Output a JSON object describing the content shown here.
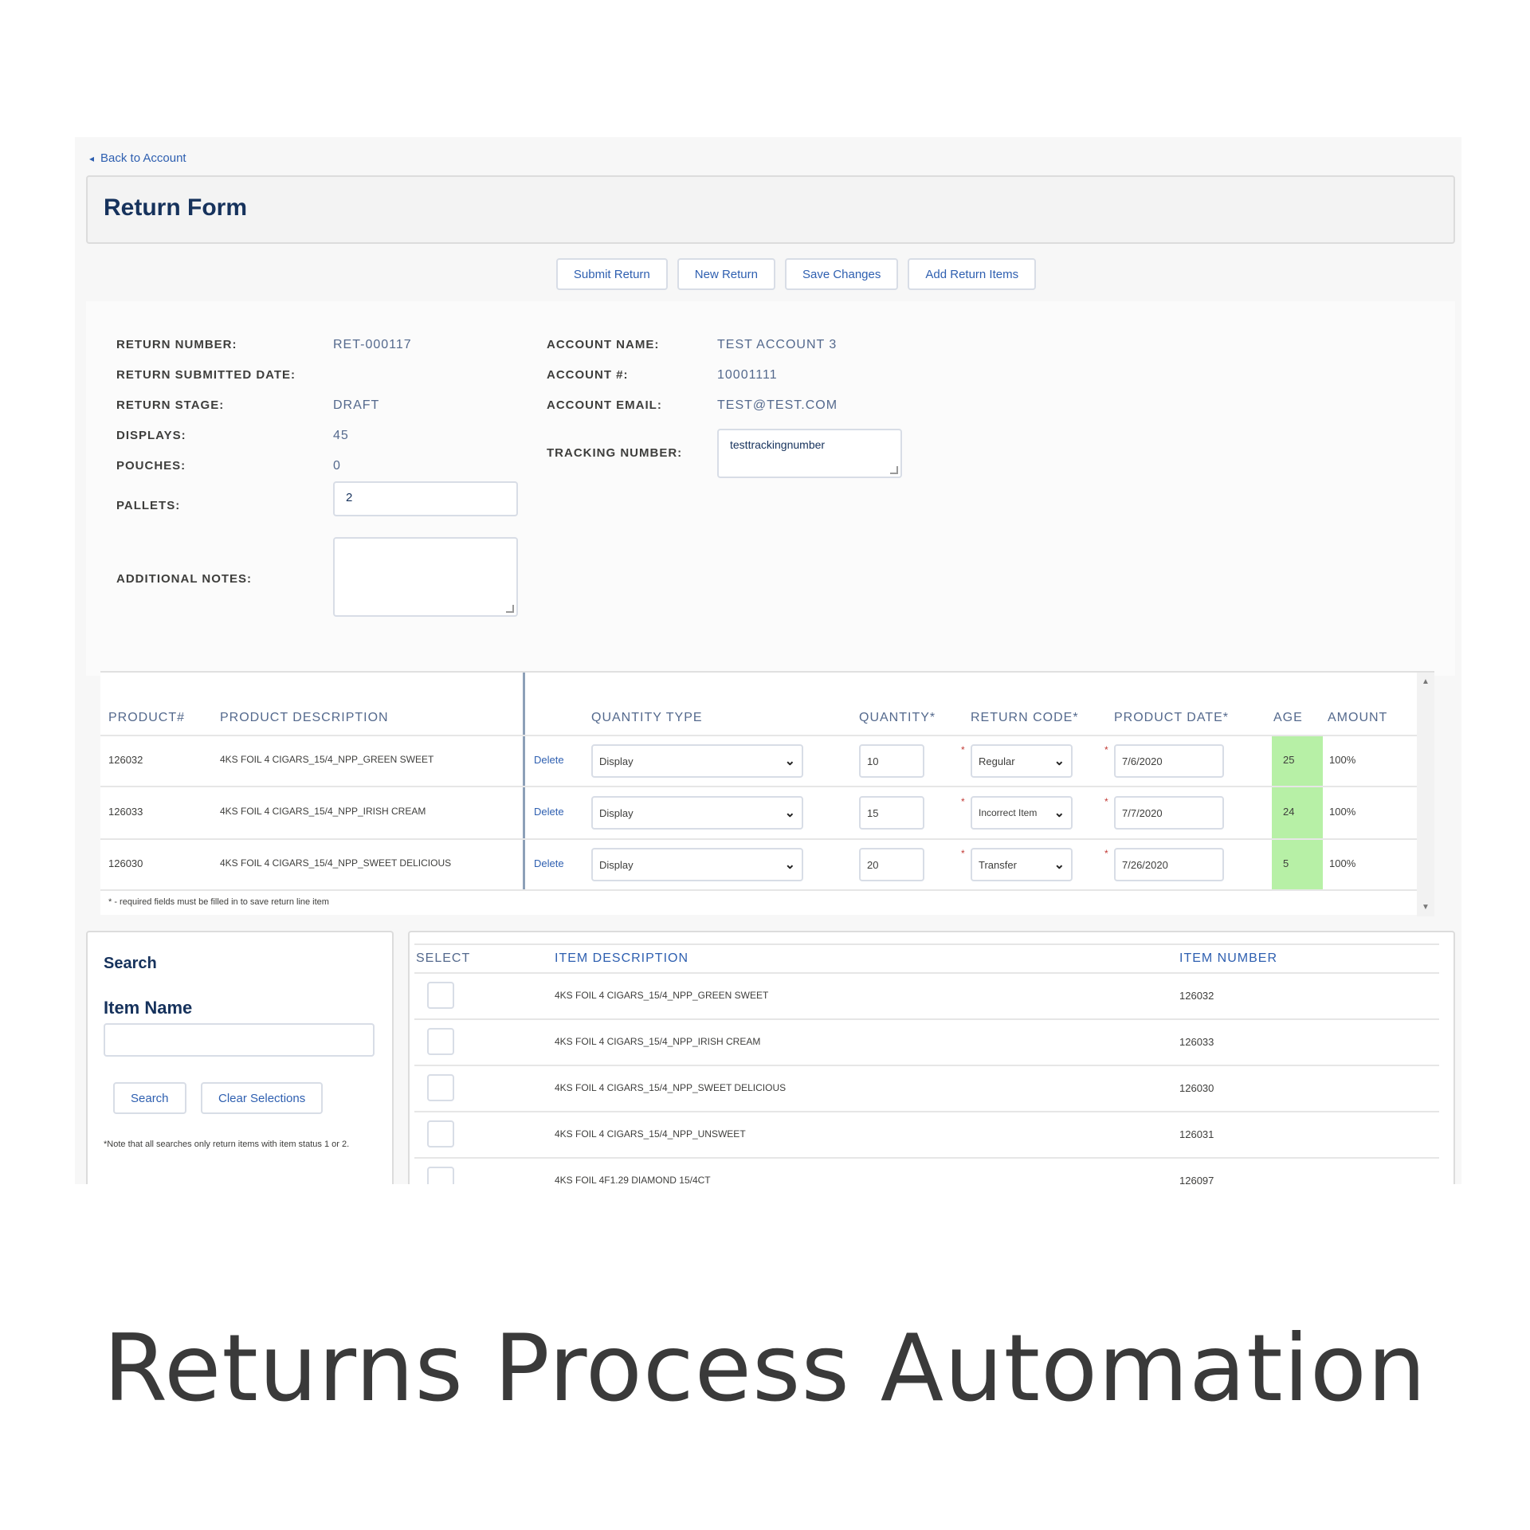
{
  "back_link": "Back to Account",
  "page_title": "Return Form",
  "buttons": {
    "submit": "Submit Return",
    "new": "New Return",
    "save": "Save Changes",
    "add": "Add Return Items"
  },
  "details": {
    "return_number_label": "RETURN NUMBER:",
    "return_number": "RET-000117",
    "submitted_date_label": "RETURN SUBMITTED DATE:",
    "stage_label": "RETURN STAGE:",
    "stage": "DRAFT",
    "displays_label": "DISPLAYS:",
    "displays": "45",
    "pouches_label": "POUCHES:",
    "pouches": "0",
    "pallets_label": "PALLETS:",
    "pallets": "2",
    "notes_label": "ADDITIONAL NOTES:",
    "notes": "",
    "account_name_label": "ACCOUNT NAME:",
    "account_name": "TEST ACCOUNT 3",
    "account_number_label": "ACCOUNT #:",
    "account_number": "10001111",
    "account_email_label": "ACCOUNT EMAIL:",
    "account_email": "TEST@TEST.COM",
    "tracking_label": "TRACKING NUMBER:",
    "tracking": "testtrackingnumber"
  },
  "items_table": {
    "headers": {
      "product": "PRODUCT#",
      "description": "PRODUCT DESCRIPTION",
      "qty_type": "QUANTITY TYPE",
      "quantity": "QUANTITY*",
      "return_code": "RETURN CODE*",
      "product_date": "PRODUCT DATE*",
      "age": "AGE",
      "amount": "AMOUNT"
    },
    "delete_label": "Delete",
    "rows": [
      {
        "product": "126032",
        "description": "4KS FOIL 4 CIGARS_15/4_NPP_GREEN SWEET",
        "qty_type": "Display",
        "quantity": "10",
        "return_code": "Regular",
        "product_date": "7/6/2020",
        "age": "25",
        "amount": "100%"
      },
      {
        "product": "126033",
        "description": "4KS FOIL 4 CIGARS_15/4_NPP_IRISH CREAM",
        "qty_type": "Display",
        "quantity": "15",
        "return_code": "Incorrect Item",
        "product_date": "7/7/2020",
        "age": "24",
        "amount": "100%"
      },
      {
        "product": "126030",
        "description": "4KS FOIL 4 CIGARS_15/4_NPP_SWEET DELICIOUS",
        "qty_type": "Display",
        "quantity": "20",
        "return_code": "Transfer",
        "product_date": "7/26/2020",
        "age": "5",
        "amount": "100%"
      }
    ],
    "footnote": "* - required fields must be filled in to save return line item"
  },
  "search": {
    "title": "Search",
    "field_label": "Item Name",
    "field_value": "",
    "search_button": "Search",
    "clear_button": "Clear Selections",
    "note": "*Note that all searches only return items with item status 1 or 2."
  },
  "results": {
    "headers": {
      "select": "SELECT",
      "description": "ITEM DESCRIPTION",
      "number": "ITEM NUMBER"
    },
    "rows": [
      {
        "description": "4KS FOIL 4 CIGARS_15/4_NPP_GREEN SWEET",
        "number": "126032"
      },
      {
        "description": "4KS FOIL 4 CIGARS_15/4_NPP_IRISH CREAM",
        "number": "126033"
      },
      {
        "description": "4KS FOIL 4 CIGARS_15/4_NPP_SWEET DELICIOUS",
        "number": "126030"
      },
      {
        "description": "4KS FOIL 4 CIGARS_15/4_NPP_UNSWEET",
        "number": "126031"
      },
      {
        "description": "4KS FOIL 4F1.29 DIAMOND 15/4CT",
        "number": "126097"
      }
    ]
  },
  "caption": "Returns Process Automation",
  "colors": {
    "link": "#2e5fb0",
    "title": "#16325c",
    "age_highlight": "#b7f0a6"
  }
}
